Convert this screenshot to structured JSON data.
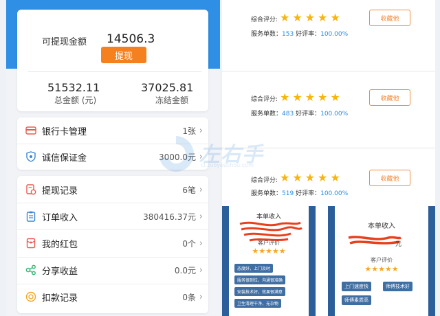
{
  "balance": {
    "withdrawable_label": "可提现金额",
    "withdrawable_value": "14506.3",
    "withdraw_button": "提现",
    "total_value": "51532.11",
    "total_label": "总金额 (元)",
    "frozen_value": "37025.81",
    "frozen_label": "冻结金额"
  },
  "menu_top": [
    {
      "label": "银行卡管理",
      "value": "1张",
      "icon": "bank-card-icon",
      "color": "#e85a4f"
    },
    {
      "label": "诚信保证金",
      "value": "3000.0元",
      "icon": "shield-icon",
      "color": "#3b83d6"
    }
  ],
  "menu_main": [
    {
      "label": "提现记录",
      "value": "6笔",
      "icon": "withdraw-record-icon",
      "color": "#e85a4f"
    },
    {
      "label": "订单收入",
      "value": "380416.37元",
      "icon": "order-clipboard-icon",
      "color": "#3b83d6"
    },
    {
      "label": "我的红包",
      "value": "0个",
      "icon": "red-packet-icon",
      "color": "#e85a4f"
    },
    {
      "label": "分享收益",
      "value": "0.0元",
      "icon": "share-icon",
      "color": "#2eb36b"
    },
    {
      "label": "扣款记录",
      "value": "0条",
      "icon": "deduction-icon",
      "color": "#f5a623"
    }
  ],
  "reviews": [
    {
      "rating_label": "综合评分:",
      "svc_label": "服务单数：",
      "svc_count": "153",
      "praise_label": "好评率：",
      "praise_rate": "100.00%",
      "fav_button": "收藏他"
    },
    {
      "rating_label": "综合评分:",
      "svc_label": "服务单数：",
      "svc_count": "483",
      "praise_label": "好评率：",
      "praise_rate": "100.00%",
      "fav_button": "收藏他"
    },
    {
      "rating_label": "综合评分:",
      "svc_label": "服务单数：",
      "svc_count": "519",
      "praise_label": "好评率：",
      "praise_rate": "100.00%",
      "fav_button": "收藏他"
    }
  ],
  "star_count": 5,
  "shot_a": {
    "income_title": "本单收入",
    "eval_label": "客户评价",
    "tags": [
      "态度好，上门及时",
      "服务很到位，沟通很准确",
      "安装技术好，效果很满意",
      "卫生清理干净，无杂物"
    ]
  },
  "shot_b": {
    "income_title": "本单收入",
    "amount_suffix": "元",
    "eval_label": "客户评价",
    "tags": [
      "上门速度快",
      "师傅技术好",
      "师傅素质高"
    ]
  },
  "watermark": {
    "text": "左右手",
    "url": "cl.zuoyoushou.com"
  }
}
